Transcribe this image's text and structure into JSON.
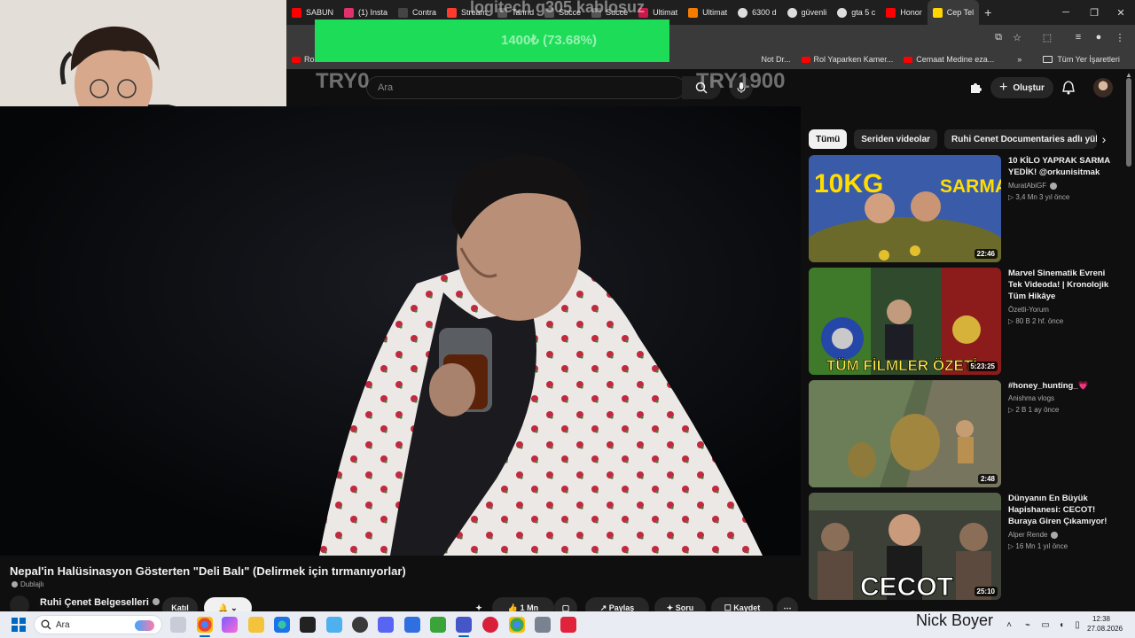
{
  "browser": {
    "tabs": [
      {
        "label": "SABUN",
        "color": "#ff0000"
      },
      {
        "label": "(1) Insta",
        "color": "#e1306c"
      },
      {
        "label": "Contra",
        "color": "#444444"
      },
      {
        "label": "Stream",
        "color": "#ff3b30"
      },
      {
        "label": "Tanrıd",
        "color": "#555555"
      },
      {
        "label": "Succe",
        "color": "#555555"
      },
      {
        "label": "Succe",
        "color": "#555555"
      },
      {
        "label": "Ultimat",
        "color": "#c9184a"
      },
      {
        "label": "Ultimat",
        "color": "#f57c00"
      },
      {
        "label": "6300 d",
        "color": "#dddddd"
      },
      {
        "label": "güvenli",
        "color": "#dddddd"
      },
      {
        "label": "gta 5 c",
        "color": "#dddddd"
      },
      {
        "label": "Honor",
        "color": "#ff0000"
      },
      {
        "label": "Cep Tel",
        "color": "#ffd600"
      }
    ],
    "bookmarks": [
      {
        "label": "Ro"
      },
      {
        "label": "Not Dr..."
      },
      {
        "label": "Rol Yaparken Kamer..."
      },
      {
        "label": "Cemaat Medine eza..."
      }
    ],
    "all_bookmarks": "Tüm Yer İşaretleri"
  },
  "overlay": {
    "donation_title": "logitech g305 kablosuz",
    "donation_progress": "1400₺ (73.68%)",
    "donation_fraction": 0.7368,
    "try_min": "TRY0",
    "try_max": "TRY1900"
  },
  "youtube": {
    "search_placeholder": "Ara",
    "create_label": "Oluştur",
    "video_title": "Nepal'in Halüsinasyon Gösterten \"Deli Balı\" (Delirmek için tırmanıyorlar)",
    "dubbed_label": "Dublajlı",
    "channel_name": "Ruhi Çenet Belgeselleri",
    "join_label": "Katıl",
    "likes": "1 Mn",
    "share_label": "Paylaş",
    "ask_label": "Soru",
    "save_label": "Kaydet",
    "chips": [
      "Tümü",
      "Seriden videolar",
      "Ruhi Cenet Documentaries adlı yükleyici"
    ],
    "recommendations": [
      {
        "title": "10 KİLO YAPRAK SARMA YEDİK! @orkunisitmak",
        "channel": "MuratAbiGF",
        "verified": true,
        "meta": "▷ 3,4 Mn   3 yıl önce",
        "duration": "22:46"
      },
      {
        "title": "Marvel Sinematik Evreni Tek Videoda! | Kronolojik Tüm Hikâye",
        "channel": "Özetli-Yorum",
        "verified": false,
        "meta": "▷ 80 B   2 hf. önce",
        "duration": "5:23:25"
      },
      {
        "title": "#honey_hunting_💗",
        "channel": "Anishma vlogs",
        "verified": false,
        "meta": "▷ 2 B   1 ay önce",
        "duration": "2:48"
      },
      {
        "title": "Dünyanın En Büyük Hapishanesi: CECOT! Buraya Giren Çıkamıyor!",
        "channel": "Alper Rende",
        "verified": true,
        "meta": "▷ 16 Mn   1 yıl önce",
        "duration": "25:10"
      }
    ],
    "thumb_texts": {
      "first_left": "10KG",
      "first_right": "SARMA",
      "second": "TÜM FİLMLER ÖZETİ",
      "fourth": "CECOT"
    }
  },
  "taskbar": {
    "search_placeholder": "Ara",
    "streamer_name": "Nick Boyer",
    "time": "12:38",
    "date": "27.08.2026"
  }
}
